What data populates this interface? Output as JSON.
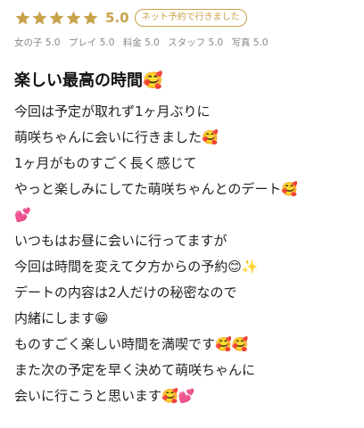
{
  "review": {
    "rating_value": "5.0",
    "stars": 5,
    "star_color": "#c9a24a",
    "badge": "ネット予約で行きました",
    "sub_ratings": [
      {
        "label": "女の子",
        "value": "5.0"
      },
      {
        "label": "プレイ",
        "value": "5.0"
      },
      {
        "label": "料金",
        "value": "5.0"
      },
      {
        "label": "スタッフ",
        "value": "5.0"
      },
      {
        "label": "写真",
        "value": "5.0"
      }
    ],
    "title": "楽しい最高の時間🥰",
    "lines": [
      "今回は予定が取れず1ヶ月ぶりに",
      "萌咲ちゃんに会いに行きました🥰",
      "1ヶ月がものすごく長く感じて",
      "やっと楽しみにしてた萌咲ちゃんとのデート🥰",
      "💕",
      "いつもはお昼に会いに行ってますが",
      "今回は時間を変えて夕方からの予約😊✨",
      "デートの内容は2人だけの秘密なので",
      "内緒にします😁",
      "ものすごく楽しい時間を満喫です🥰🥰",
      "また次の予定を早く決めて萌咲ちゃんに",
      "会いに行こうと思います🥰💕"
    ]
  }
}
